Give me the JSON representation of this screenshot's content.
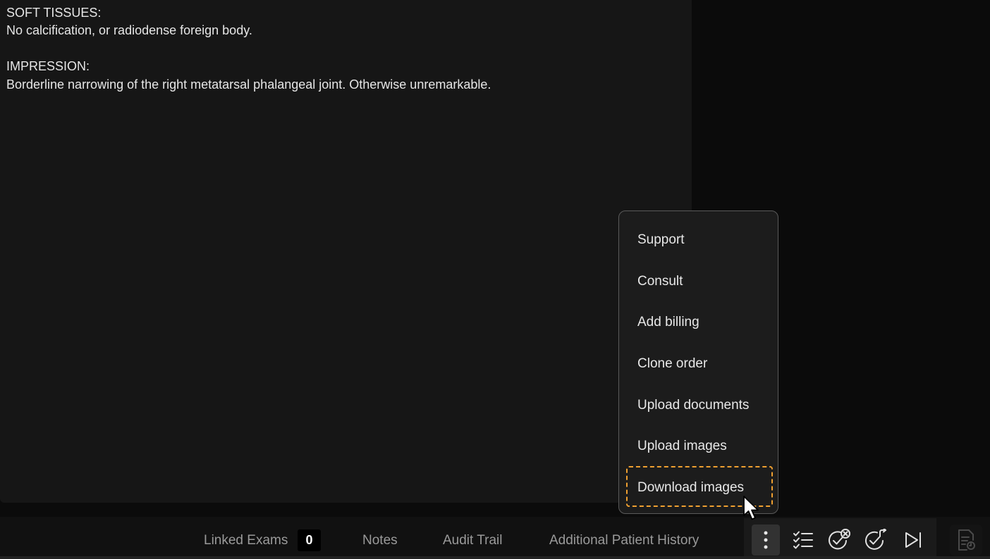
{
  "report": {
    "text": "SOFT TISSUES:\nNo calcification, or radiodense foreign body.\n\nIMPRESSION:\nBorderline narrowing of the right metatarsal phalangeal joint. Otherwise unremarkable."
  },
  "bottom_tabs": {
    "linked_exams_label": "Linked Exams",
    "linked_exams_count": "0",
    "notes_label": "Notes",
    "audit_trail_label": "Audit Trail",
    "additional_history_label": "Additional Patient History"
  },
  "more_menu": {
    "items": [
      {
        "label": "Support"
      },
      {
        "label": "Consult"
      },
      {
        "label": "Add billing"
      },
      {
        "label": "Clone order"
      },
      {
        "label": "Upload documents"
      },
      {
        "label": "Upload images"
      },
      {
        "label": "Download images"
      }
    ],
    "focused_item": "Download images"
  },
  "action_icons": [
    "more-vertical-icon",
    "checklist-icon",
    "check-circle-x-icon",
    "check-circle-forward-icon",
    "skip-next-icon",
    "report-document-icon"
  ],
  "colors": {
    "focus_outline": "#f0a030",
    "panel_bg": "#161616",
    "page_bg": "#0b0b0b"
  }
}
